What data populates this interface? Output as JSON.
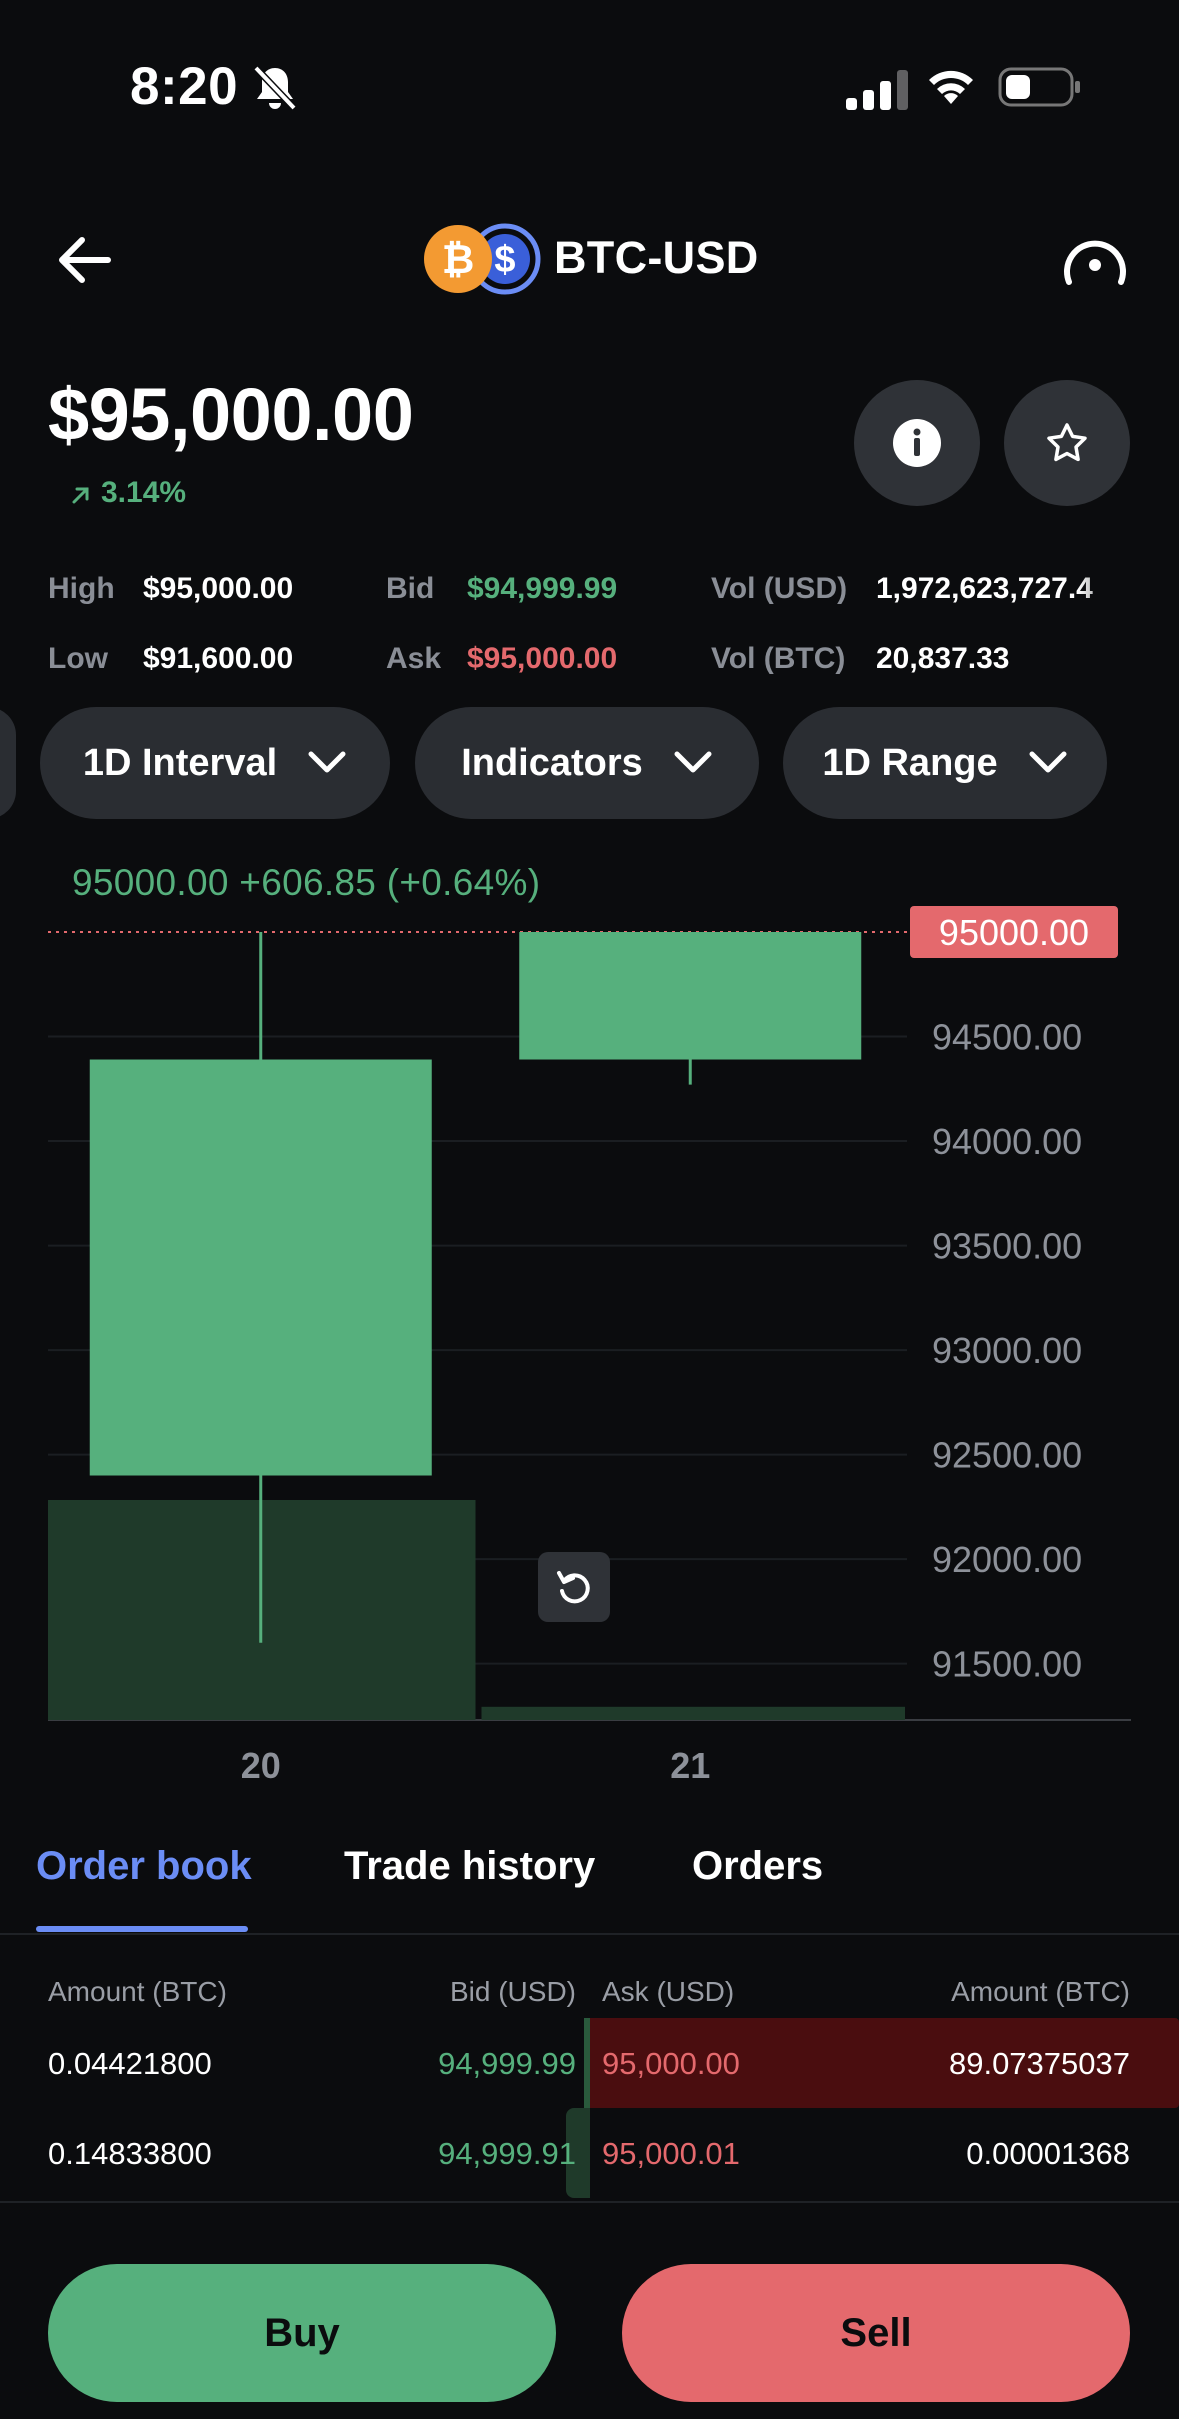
{
  "status_bar": {
    "time": "8:20"
  },
  "header": {
    "pair": "BTC-USD"
  },
  "price": {
    "value": "$95,000.00",
    "change": "3.14%"
  },
  "stats": {
    "high_label": "High",
    "high": "$95,000.00",
    "low_label": "Low",
    "low": "$91,600.00",
    "bid_label": "Bid",
    "bid": "$94,999.99",
    "ask_label": "Ask",
    "ask": "$95,000.00",
    "vol_usd_label": "Vol (USD)",
    "vol_usd": "1,972,623,727.4",
    "vol_btc_label": "Vol (BTC)",
    "vol_btc": "20,837.33"
  },
  "filters": {
    "interval": "1D Interval",
    "indicators": "Indicators",
    "range": "1D Range"
  },
  "chart_data": {
    "type": "candlestick",
    "legend": "95000.00  +606.85 (+0.64%)",
    "current_price_label": "95000.00",
    "y_ticks": [
      "94500.00",
      "94000.00",
      "93500.00",
      "93000.00",
      "92500.00",
      "92000.00",
      "91500.00"
    ],
    "ylim": [
      91240,
      95000
    ],
    "x": [
      "20",
      "21"
    ],
    "candles": [
      {
        "x": "20",
        "open": 92400,
        "close": 94390,
        "high": 95000,
        "low": 91600
      },
      {
        "x": "21",
        "open": 94390,
        "close": 95000,
        "high": 95000,
        "low": 94270
      }
    ],
    "volume_relative": [
      1.0,
      0.06
    ],
    "colors": {
      "up": "#56b07d",
      "volume": "#1f3a2a",
      "grid": "#1b1e22",
      "current": "#e4696d"
    }
  },
  "tabs": [
    {
      "label": "Order book",
      "active": true
    },
    {
      "label": "Trade history",
      "active": false
    },
    {
      "label": "Orders",
      "active": false
    }
  ],
  "order_book": {
    "headers": {
      "bid_amount": "Amount (BTC)",
      "bid": "Bid (USD)",
      "ask": "Ask (USD)",
      "ask_amount": "Amount (BTC)"
    },
    "rows": [
      {
        "bid_amount": "0.04421800",
        "bid": "94,999.99",
        "ask": "95,000.00",
        "ask_amount": "89.07375037"
      },
      {
        "bid_amount": "0.14833800",
        "bid": "94,999.91",
        "ask": "95,000.01",
        "ask_amount": "0.00001368"
      }
    ]
  },
  "actions": {
    "buy": "Buy",
    "sell": "Sell"
  },
  "colors": {
    "green": "#56b07d",
    "red": "#e4696d",
    "accent": "#6b8df5",
    "background": "#0b0c0e"
  }
}
